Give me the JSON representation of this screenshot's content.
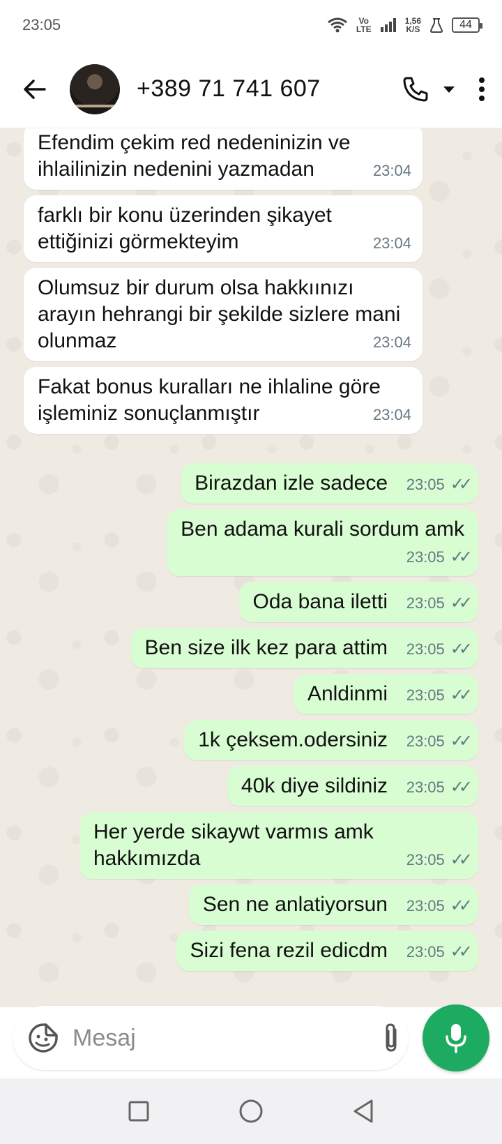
{
  "status_bar": {
    "time": "23:05",
    "volte_top": "Vo",
    "volte_bottom": "LTE",
    "speed_top": "1,56",
    "speed_bottom": "K/S",
    "battery": "44"
  },
  "header": {
    "contact_name": "+389 71 741 607"
  },
  "messages": [
    {
      "type": "incoming",
      "text": "Efendim çekim red nedeninizin ve ihlailinizin nedenini yazmadan",
      "time": "23:04"
    },
    {
      "type": "incoming",
      "text": "farklı bir konu üzerinden şikayet ettiğinizi görmekteyim",
      "time": "23:04"
    },
    {
      "type": "incoming",
      "text": "Olumsuz bir durum olsa hakkıınızı arayın hehrangi bir şekilde sizlere mani olunmaz",
      "time": "23:04"
    },
    {
      "type": "incoming",
      "text": "Fakat bonus kuralları ne ihlaline göre işleminiz sonuçlanmıştır",
      "time": "23:04"
    },
    {
      "type": "outgoing",
      "text": "Birazdan izle sadece",
      "time": "23:05"
    },
    {
      "type": "outgoing",
      "text": "Ben adama kurali sordum amk",
      "time": "23:05"
    },
    {
      "type": "outgoing",
      "text": "Oda bana iletti",
      "time": "23:05"
    },
    {
      "type": "outgoing",
      "text": "Ben size ilk kez para attim",
      "time": "23:05"
    },
    {
      "type": "outgoing",
      "text": "Anldinmi",
      "time": "23:05"
    },
    {
      "type": "outgoing",
      "text": "1k çeksem.odersiniz",
      "time": "23:05"
    },
    {
      "type": "outgoing",
      "text": "40k diye sildiniz",
      "time": "23:05"
    },
    {
      "type": "outgoing",
      "text": "Her yerde sikaywt varmıs amk hakkımızda",
      "time": "23:05"
    },
    {
      "type": "outgoing",
      "text": "Sen ne anlatiyorsun",
      "time": "23:05"
    },
    {
      "type": "outgoing",
      "text": "Sizi fena rezil edicdm",
      "time": "23:05"
    }
  ],
  "composer": {
    "placeholder": "Mesaj"
  },
  "colors": {
    "incoming_bubble": "#ffffff",
    "outgoing_bubble": "#d9fdd3",
    "chat_background": "#efeae2",
    "mic_button": "#1daa61",
    "timestamp": "#667781"
  },
  "icons": {
    "back": "arrow-left-icon",
    "call": "phone-icon",
    "call_menu": "caret-down-icon",
    "menu": "more-vertical-icon",
    "emoji": "sticker-icon",
    "attach": "paperclip-icon",
    "camera": "camera-icon",
    "mic": "mic-icon",
    "nav_recents": "square-icon",
    "nav_home": "circle-icon",
    "nav_back": "triangle-back-icon"
  }
}
